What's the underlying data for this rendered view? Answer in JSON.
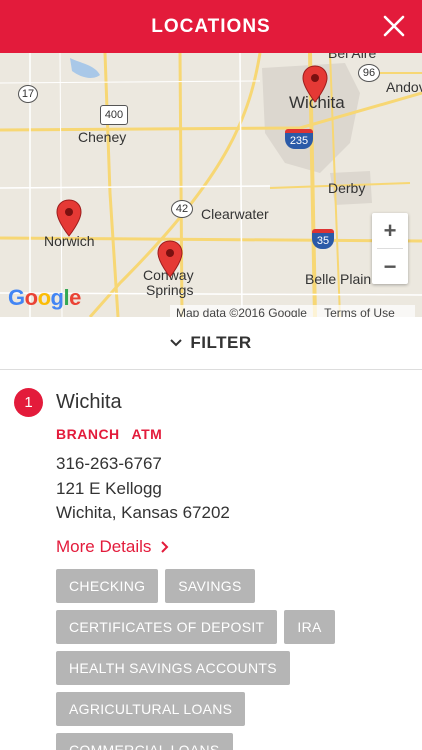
{
  "header": {
    "title": "LOCATIONS",
    "close_icon": "close-icon"
  },
  "map": {
    "labels": {
      "wichita": "Wichita",
      "cheney": "Cheney",
      "derby": "Derby",
      "clearwater": "Clearwater",
      "norwich": "Norwich",
      "conway": "Conway",
      "springs": "Springs",
      "belle_plain": "Belle Plain",
      "bel_aire": "Bel Aire",
      "andover": "Andov"
    },
    "shields": {
      "r17": "17",
      "r400": "400",
      "r96": "96",
      "r235": "235",
      "r42": "42",
      "r35": "35"
    },
    "zoom_in": "+",
    "zoom_out": "−",
    "logo": {
      "G": "G",
      "o1": "o",
      "o2": "o",
      "g": "g",
      "l": "l",
      "e": "e"
    },
    "footer": {
      "data": "Map data ©2016 Google",
      "terms": "Terms of Use"
    },
    "colors": {
      "land": "#ece8df",
      "road": "#f7d774",
      "urban": "#dcd7cf",
      "pin": "#e53935"
    }
  },
  "filter": {
    "label": "FILTER"
  },
  "location": {
    "number": "1",
    "name": "Wichita",
    "types": [
      "BRANCH",
      "ATM"
    ],
    "phone": "316-263-6767",
    "address1": "121 E Kellogg",
    "address2": "Wichita, Kansas 67202",
    "more_details": "More Details",
    "tags": [
      [
        "CHECKING",
        "SAVINGS"
      ],
      [
        "CERTIFICATES OF DEPOSIT",
        "IRA"
      ],
      [
        "HEALTH SAVINGS ACCOUNTS"
      ],
      [
        "AGRICULTURAL LOANS"
      ],
      [
        "COMMERCIAL LOANS"
      ]
    ]
  },
  "colors": {
    "accent": "#e31b3b",
    "tag_bg": "#b5b5b5"
  }
}
